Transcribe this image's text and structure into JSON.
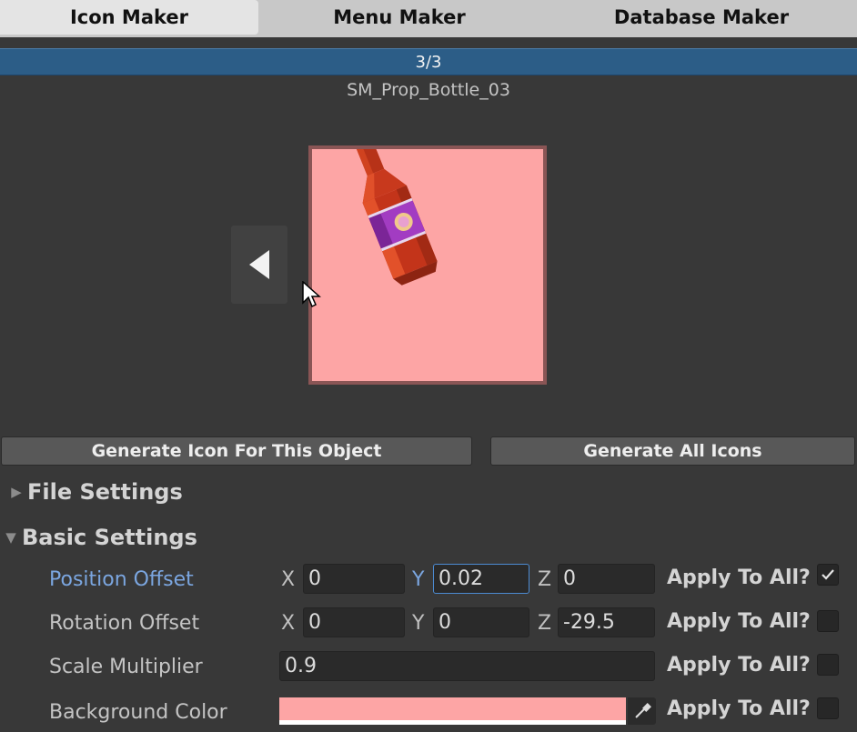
{
  "tabs": [
    {
      "label": "Icon Maker",
      "active": true
    },
    {
      "label": "Menu Maker",
      "active": false
    },
    {
      "label": "Database Maker",
      "active": false
    }
  ],
  "progress": {
    "label": "3/3",
    "fill": 1.0
  },
  "object_name": "SM_Prop_Bottle_03",
  "preview": {
    "background_color": "#fda5a5",
    "border_color": "#8a5555"
  },
  "buttons": {
    "generate_one": "Generate Icon For This Object",
    "generate_all": "Generate All Icons"
  },
  "sections": {
    "file_settings": {
      "label": "File Settings",
      "expanded": false
    },
    "basic_settings": {
      "label": "Basic Settings",
      "expanded": true
    }
  },
  "axes": {
    "x": "X",
    "y": "Y",
    "z": "Z"
  },
  "apply_label": "Apply To All?",
  "settings": {
    "position_offset": {
      "label": "Position Offset",
      "x": "0",
      "y": "0.02",
      "z": "0",
      "apply_to_all": true
    },
    "rotation_offset": {
      "label": "Rotation Offset",
      "x": "0",
      "y": "0",
      "z": "-29.5",
      "apply_to_all": false
    },
    "scale_multiplier": {
      "label": "Scale Multiplier",
      "value": "0.9",
      "apply_to_all": false
    },
    "background_color": {
      "label": "Background Color",
      "value": "#fda5a5",
      "apply_to_all": false
    }
  },
  "colors": {
    "accent_blue": "#2c5d87",
    "focus_blue": "#7ba6e0"
  }
}
